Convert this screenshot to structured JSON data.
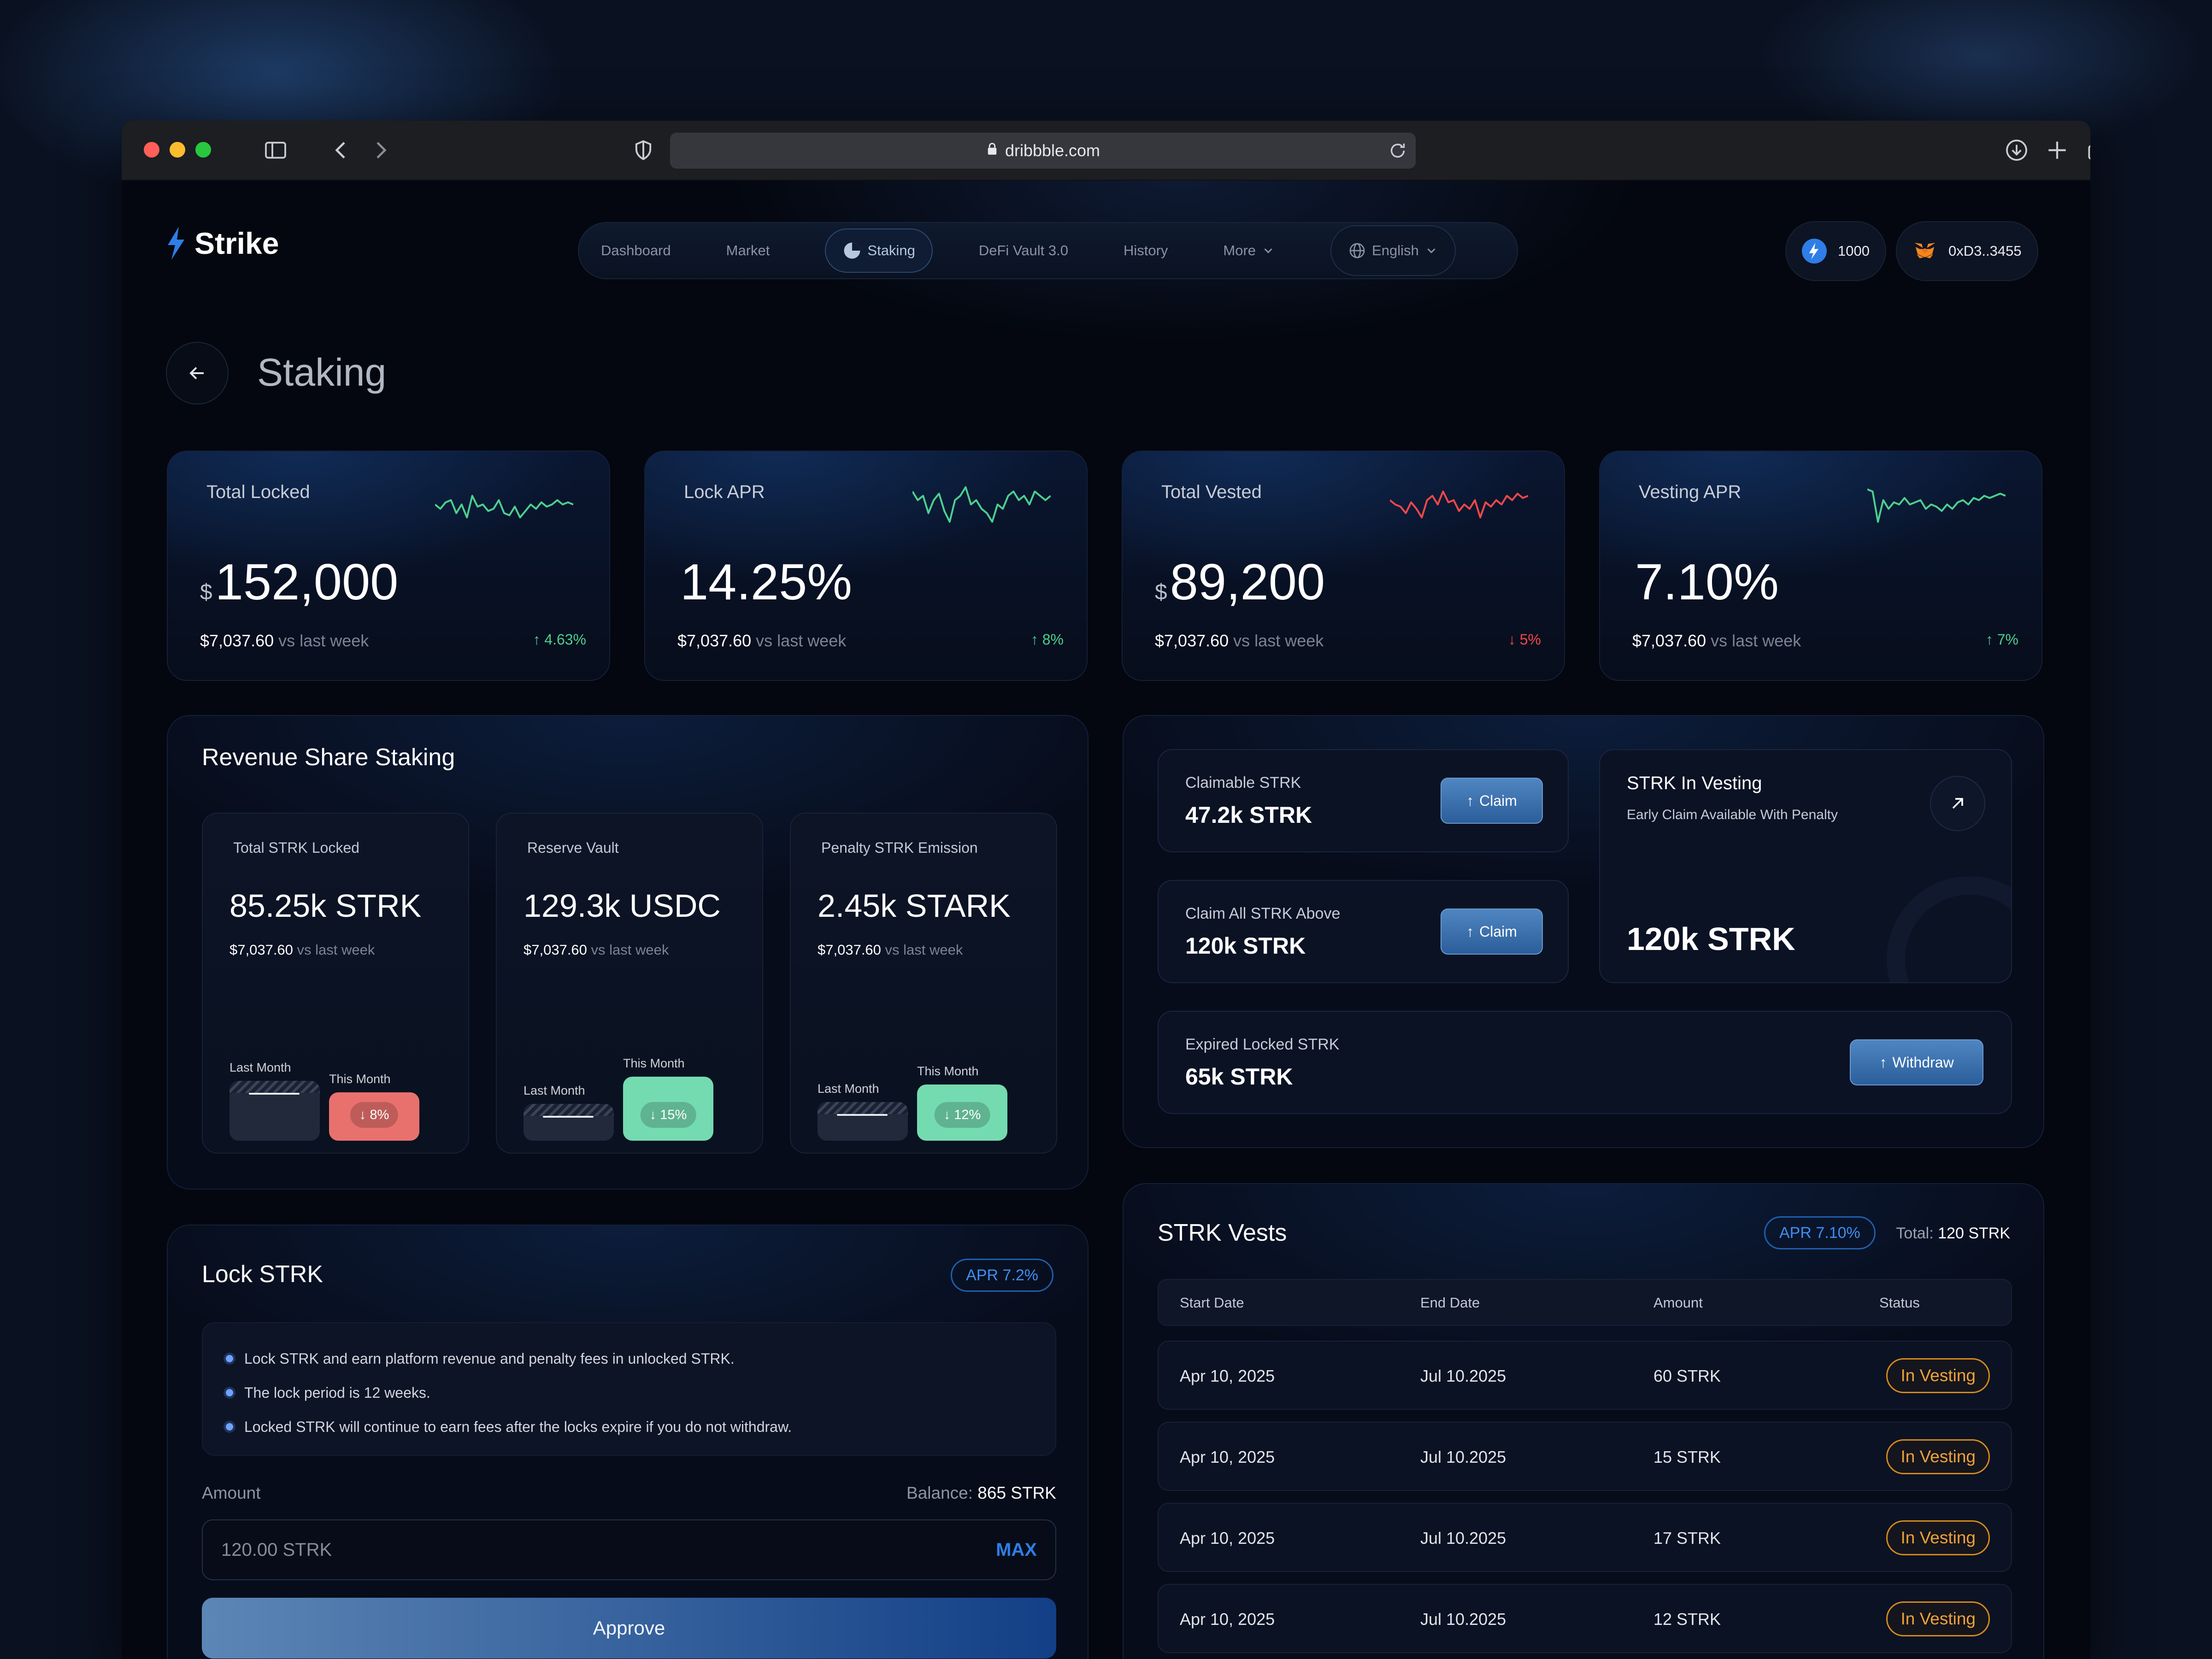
{
  "browser": {
    "url": "dribbble.com"
  },
  "brand": {
    "name": "Strike"
  },
  "nav": {
    "items": [
      "Dashboard",
      "Market",
      "Staking",
      "DeFi Vault 3.0",
      "History",
      "More"
    ],
    "language": "English"
  },
  "header": {
    "points": "1000",
    "wallet": "0xD3..3455"
  },
  "page": {
    "title": "Staking"
  },
  "stats": [
    {
      "label": "Total Locked",
      "currency": "$",
      "value": "152,000",
      "prev": "$7,037.60",
      "suffix": "vs last week",
      "change": "↑ 4.63%",
      "trend": "up",
      "spark": [
        0.5,
        0.4,
        0.55,
        0.6,
        0.3,
        0.5,
        0.2,
        0.7,
        0.45,
        0.5,
        0.35,
        0.4,
        0.6,
        0.3,
        0.25,
        0.45,
        0.2,
        0.35,
        0.5,
        0.4,
        0.55,
        0.45,
        0.5,
        0.6,
        0.5,
        0.55,
        0.5
      ]
    },
    {
      "label": "Lock APR",
      "currency": "",
      "value": "14.25%",
      "prev": "$7,037.60",
      "suffix": "vs last week",
      "change": "↑ 8%",
      "trend": "up",
      "spark": [
        0.8,
        0.6,
        0.7,
        0.3,
        0.6,
        0.75,
        0.35,
        0.1,
        0.6,
        0.7,
        0.9,
        0.5,
        0.6,
        0.4,
        0.3,
        0.1,
        0.5,
        0.4,
        0.7,
        0.8,
        0.6,
        0.7,
        0.5,
        0.8,
        0.7,
        0.6,
        0.7
      ]
    },
    {
      "label": "Total Vested",
      "currency": "$",
      "value": "89,200",
      "prev": "$7,037.60",
      "suffix": "vs last week",
      "change": "↓ 5%",
      "trend": "down",
      "spark": [
        0.6,
        0.5,
        0.45,
        0.3,
        0.55,
        0.4,
        0.2,
        0.6,
        0.7,
        0.5,
        0.8,
        0.55,
        0.6,
        0.35,
        0.5,
        0.4,
        0.6,
        0.2,
        0.55,
        0.45,
        0.6,
        0.5,
        0.7,
        0.6,
        0.75,
        0.65,
        0.7
      ]
    },
    {
      "label": "Vesting APR",
      "currency": "",
      "value": "7.10%",
      "prev": "$7,037.60",
      "suffix": "vs last week",
      "change": "↑ 7%",
      "trend": "up",
      "spark": [
        0.85,
        0.8,
        0.1,
        0.6,
        0.4,
        0.55,
        0.5,
        0.65,
        0.5,
        0.55,
        0.6,
        0.4,
        0.5,
        0.45,
        0.35,
        0.5,
        0.4,
        0.55,
        0.6,
        0.5,
        0.65,
        0.6,
        0.7,
        0.65,
        0.7,
        0.75,
        0.7
      ]
    }
  ],
  "revenue": {
    "title": "Revenue Share Staking",
    "cards": [
      {
        "label": "Total STRK Locked",
        "value": "85.25k STRK",
        "prev": "$7,037.60",
        "suffix": "vs last week",
        "last_label": "Last Month",
        "this_label": "This Month",
        "change": "↓ 8%",
        "last_level": 0.62,
        "this_level": 0.5,
        "color": "#e8716e"
      },
      {
        "label": "Reserve Vault",
        "value": "129.3k USDC",
        "prev": "$7,037.60",
        "suffix": "vs last week",
        "last_label": "Last Month",
        "this_label": "This Month",
        "change": "↓ 15%",
        "last_level": 0.38,
        "this_level": 0.66,
        "color": "#74dbb0"
      },
      {
        "label": "Penalty STRK Emission",
        "value": "2.45k STARK",
        "prev": "$7,037.60",
        "suffix": "vs last week",
        "last_label": "Last Month",
        "this_label": "This Month",
        "change": "↓ 12%",
        "last_level": 0.4,
        "this_level": 0.58,
        "color": "#74dbb0"
      }
    ]
  },
  "claims": {
    "claimable": {
      "label": "Claimable STRK",
      "value": "47.2k STRK",
      "button": "Claim"
    },
    "claim_all": {
      "label": "Claim All STRK Above",
      "value": "120k STRK",
      "button": "Claim"
    },
    "vesting": {
      "label": "STRK In Vesting",
      "subtitle": "Early Claim Available With Penalty",
      "value": "120k STRK"
    },
    "expired": {
      "label": "Expired Locked STRK",
      "value": "65k STRK",
      "button": "Withdraw"
    }
  },
  "lock": {
    "title": "Lock STRK",
    "apr": "APR 7.2%",
    "bullets": [
      "Lock STRK and earn platform revenue and penalty fees in unlocked STRK.",
      "The lock period is 12 weeks.",
      "Locked STRK will continue to earn fees after the locks expire if you do not withdraw."
    ],
    "amount_label": "Amount",
    "balance_label": "Balance:",
    "balance_value": "865 STRK",
    "input_value": "120.00 STRK",
    "max_label": "MAX",
    "approve_label": "Approve"
  },
  "vests": {
    "title": "STRK Vests",
    "apr": "APR 7.10%",
    "total_label": "Total:",
    "total_value": "120 STRK",
    "columns": [
      "Start Date",
      "End Date",
      "Amount",
      "Status"
    ],
    "rows": [
      [
        "Apr 10, 2025",
        "Jul 10.2025",
        "60 STRK",
        "In Vesting"
      ],
      [
        "Apr 10, 2025",
        "Jul 10.2025",
        "15 STRK",
        "In Vesting"
      ],
      [
        "Apr 10, 2025",
        "Jul 10.2025",
        "17 STRK",
        "In Vesting"
      ],
      [
        "Apr 10, 2025",
        "Jul 10.2025",
        "12 STRK",
        "In Vesting"
      ]
    ]
  },
  "colors": {
    "accent": "#2f7de6",
    "up": "#4ccf8f",
    "down": "#f0484a",
    "warning": "#f0a238"
  }
}
